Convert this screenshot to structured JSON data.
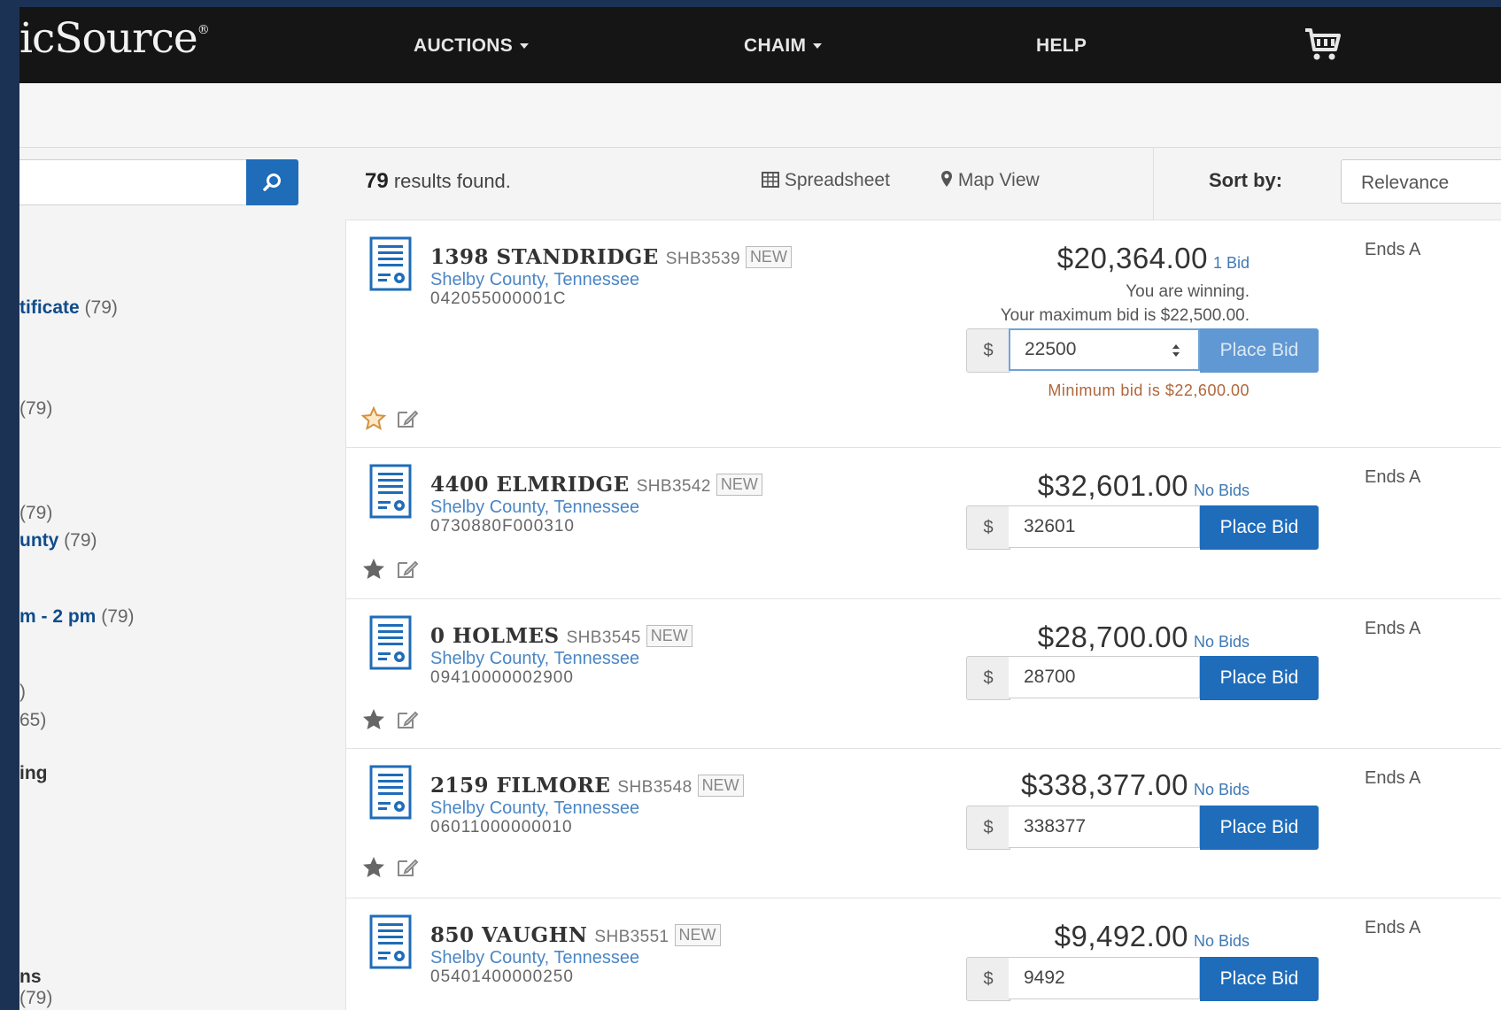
{
  "nav": {
    "logo": "icSource",
    "logo_mark": "®",
    "items": [
      {
        "label": "AUCTIONS"
      },
      {
        "label": "CHAIM"
      },
      {
        "label": "HELP"
      }
    ]
  },
  "sidebar": {
    "facets": [
      {
        "label": "tificate",
        "count": "(79)"
      },
      {
        "label": "",
        "count": "(79)"
      },
      {
        "label": "",
        "count": "(79)"
      },
      {
        "label": "unty",
        "count": "(79)"
      },
      {
        "label": "m - 2 pm",
        "count": "(79)"
      },
      {
        "label": "",
        "count": ")"
      },
      {
        "label": "",
        "count": "65)"
      },
      {
        "label": "ing",
        "count": ""
      },
      {
        "label": "ns",
        "count": ""
      },
      {
        "label": "",
        "count": "(79)"
      }
    ]
  },
  "results": {
    "count": "79",
    "count_suffix": "results found.",
    "spreadsheet_label": "Spreadsheet",
    "map_label": "Map View",
    "sort_label": "Sort by:",
    "sort_value": "Relevance"
  },
  "listings": [
    {
      "address": "1398 STANDRIDGE",
      "code": "SHB3539",
      "badge": "NEW",
      "county": "Shelby County, Tennessee",
      "parcel": "042055000001C",
      "price": "$20,364.00",
      "bids": "1 Bid",
      "status1": "You are winning.",
      "status2": "Your maximum bid is $22,500.00.",
      "currency": "$",
      "bid_value": "22500",
      "button": "Place Bid",
      "min_bid": "Minimum bid is $22,600.00",
      "ends": "Ends A"
    },
    {
      "address": "4400 ELMRIDGE",
      "code": "SHB3542",
      "badge": "NEW",
      "county": "Shelby County, Tennessee",
      "parcel": "0730880F000310",
      "price": "$32,601.00",
      "bids": "No Bids",
      "currency": "$",
      "bid_value": "32601",
      "button": "Place Bid",
      "ends": "Ends A"
    },
    {
      "address": "0 HOLMES",
      "code": "SHB3545",
      "badge": "NEW",
      "county": "Shelby County, Tennessee",
      "parcel": "09410000002900",
      "price": "$28,700.00",
      "bids": "No Bids",
      "currency": "$",
      "bid_value": "28700",
      "button": "Place Bid",
      "ends": "Ends A"
    },
    {
      "address": "2159 FILMORE",
      "code": "SHB3548",
      "badge": "NEW",
      "county": "Shelby County, Tennessee",
      "parcel": "06011000000010",
      "price": "$338,377.00",
      "bids": "No Bids",
      "currency": "$",
      "bid_value": "338377",
      "button": "Place Bid",
      "ends": "Ends A"
    },
    {
      "address": "850 VAUGHN",
      "code": "SHB3551",
      "badge": "NEW",
      "county": "Shelby County, Tennessee",
      "parcel": "05401400000250",
      "price": "$9,492.00",
      "bids": "No Bids",
      "currency": "$",
      "bid_value": "9492",
      "button": "Place Bid",
      "ends": "Ends A"
    }
  ],
  "colors": {
    "accent": "#1e6cba",
    "link": "#4a86c5",
    "warning": "#b0663a",
    "navbar": "#151515"
  },
  "icons": [
    "search-icon",
    "spreadsheet-icon",
    "map-marker-icon",
    "cart-icon",
    "certificate-icon",
    "star-icon",
    "edit-icon",
    "spinner-icon"
  ]
}
